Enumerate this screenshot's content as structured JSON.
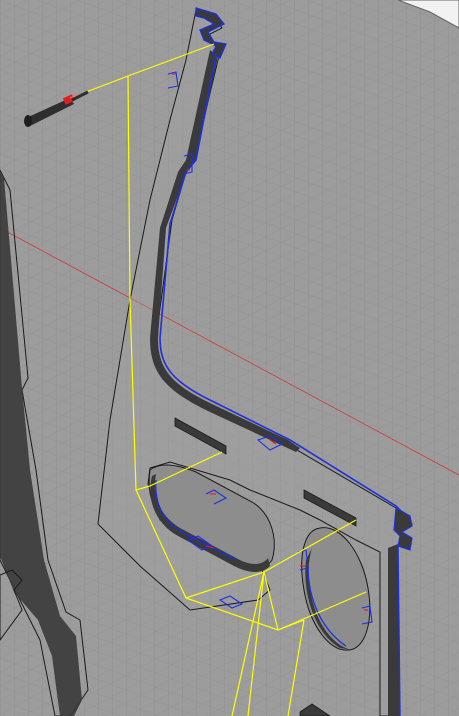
{
  "viewport": {
    "background": "#9c9c9c",
    "grid_minor_color": "#8e8e8e",
    "grid_major_color": "#7a7a7a",
    "axis_color": "#d23a3a"
  },
  "part": {
    "outline_color": "#1a1a1a",
    "edge_highlight_color": "#1d2fe0",
    "extrusion_color": "#3a3a3a",
    "selection_color": "#ffff00",
    "gizmo_color": "#2e2e2e",
    "gizmo_accent": "#e02020"
  },
  "icons": [
    "slot-feature-icon",
    "joint-marker-icon",
    "manipulator-handle-icon"
  ]
}
